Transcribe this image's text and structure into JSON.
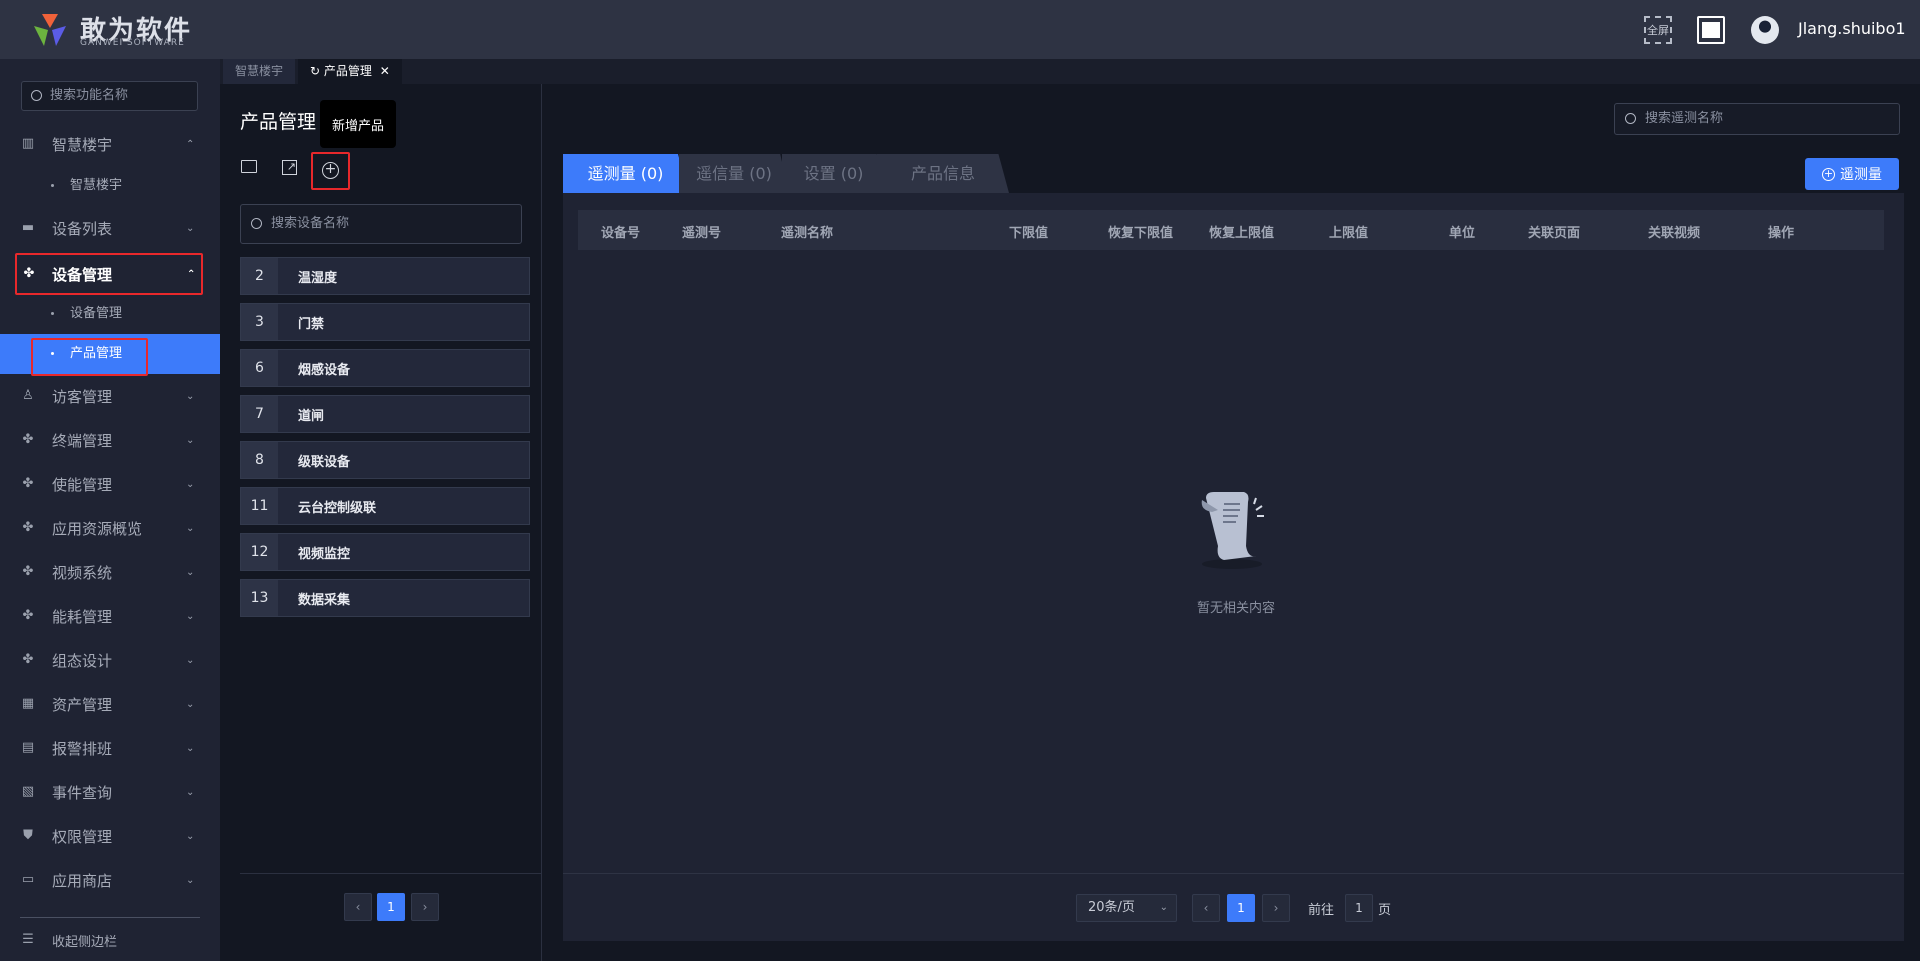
{
  "header": {
    "logo_title": "敢为软件",
    "logo_subtitle": "GANWEI SOFTWARE",
    "fullscreen_label": "全屏",
    "username": "Jlang.shuibo1"
  },
  "sidebar": {
    "search_placeholder": "搜索功能名称",
    "items": [
      {
        "label": "智慧楼宇",
        "chevron": "⌃"
      },
      {
        "label": "设备列表",
        "chevron": "⌄"
      },
      {
        "label": "设备管理",
        "chevron": "⌃"
      },
      {
        "label": "访客管理",
        "chevron": "⌄"
      },
      {
        "label": "终端管理",
        "chevron": "⌄"
      },
      {
        "label": "使能管理",
        "chevron": "⌄"
      },
      {
        "label": "应用资源概览",
        "chevron": "⌄"
      },
      {
        "label": "视频系统",
        "chevron": "⌄"
      },
      {
        "label": "能耗管理",
        "chevron": "⌄"
      },
      {
        "label": "组态设计",
        "chevron": "⌄"
      },
      {
        "label": "资产管理",
        "chevron": "⌄"
      },
      {
        "label": "报警排班",
        "chevron": "⌄"
      },
      {
        "label": "事件查询",
        "chevron": "⌄"
      },
      {
        "label": "权限管理",
        "chevron": "⌄"
      },
      {
        "label": "应用商店",
        "chevron": "⌄"
      }
    ],
    "sub_items": {
      "smart_building": "智慧楼宇",
      "device_mgmt": "设备管理",
      "product_mgmt": "产品管理"
    },
    "collapse_label": "收起侧边栏"
  },
  "page_tabs": [
    {
      "label": "智慧楼宇"
    },
    {
      "label": "产品管理",
      "close": "✕",
      "refresh": "↻"
    }
  ],
  "left": {
    "title": "产品管理",
    "tooltip": "新增产品",
    "search_placeholder": "搜索设备名称",
    "products": [
      {
        "id": "2",
        "name": "温湿度"
      },
      {
        "id": "3",
        "name": "门禁"
      },
      {
        "id": "6",
        "name": "烟感设备"
      },
      {
        "id": "7",
        "name": "道闸"
      },
      {
        "id": "8",
        "name": "级联设备"
      },
      {
        "id": "11",
        "name": "云台控制级联"
      },
      {
        "id": "12",
        "name": "视频监控"
      },
      {
        "id": "13",
        "name": "数据采集"
      }
    ],
    "pagination": {
      "prev": "‹",
      "current": "1",
      "next": "›"
    }
  },
  "right": {
    "search_placeholder": "搜索遥测名称",
    "tabs": [
      "遥测量 (0)",
      "遥信量 (0)",
      "设置 (0)",
      "产品信息"
    ],
    "add_button": "遥测量",
    "columns": [
      "设备号",
      "遥测号",
      "遥测名称",
      "下限值",
      "恢复下限值",
      "恢复上限值",
      "上限值",
      "单位",
      "关联页面",
      "关联视频",
      "操作"
    ],
    "empty_text": "暂无相关内容",
    "pagination": {
      "page_size": "20条/页",
      "prev": "‹",
      "current": "1",
      "next": "›",
      "goto_label": "前往",
      "goto_value": "1",
      "page_suffix": "页"
    }
  },
  "colors": {
    "accent": "#3d7bfa",
    "highlight_border": "#e8282b"
  }
}
